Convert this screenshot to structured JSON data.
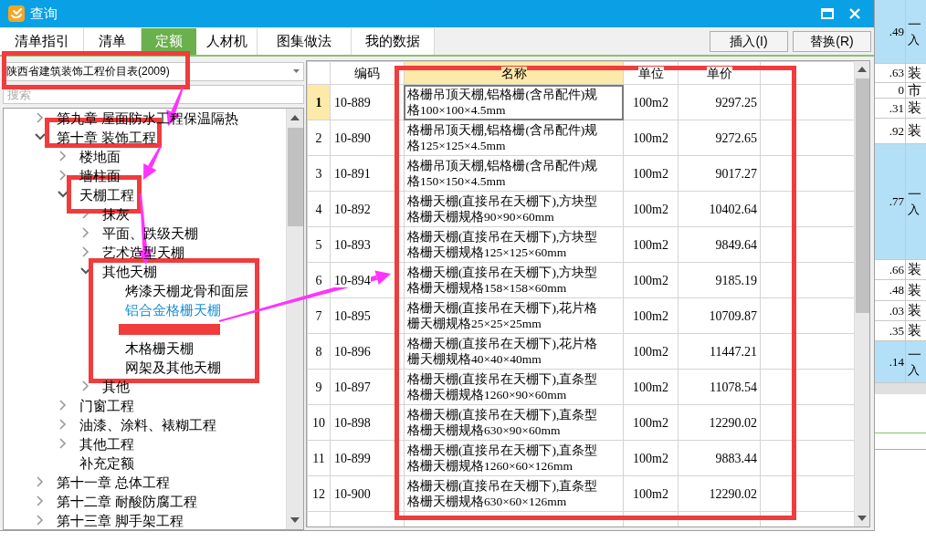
{
  "window": {
    "title": "查询"
  },
  "tabs": [
    {
      "label": "清单指引",
      "selected": false
    },
    {
      "label": "清单",
      "selected": false
    },
    {
      "label": "定额",
      "selected": true
    },
    {
      "label": "人材机",
      "selected": false
    },
    {
      "label": "图集做法",
      "selected": false
    },
    {
      "label": "我的数据",
      "selected": false
    }
  ],
  "buttons": [
    "插入(I)",
    "替换(R)"
  ],
  "library_dropdown": {
    "value": "陕西省建筑装饰工程价目表(2009)"
  },
  "search": {
    "placeholder": "搜索"
  },
  "tree": [
    {
      "label": "第九章 屋面防水工程保温隔热",
      "expanded": false,
      "selected": false
    },
    {
      "label": "第十章 装饰工程",
      "expanded": true,
      "selected": false,
      "children": [
        {
          "label": "楼地面",
          "expanded": false,
          "selected": false
        },
        {
          "label": "墙柱面",
          "expanded": false,
          "selected": false
        },
        {
          "label": "天棚工程",
          "expanded": true,
          "selected": false,
          "children": [
            {
              "label": "抹灰",
              "expanded": false,
              "selected": false
            },
            {
              "label": "平面、跌级天棚",
              "expanded": false,
              "selected": false
            },
            {
              "label": "艺术造型天棚",
              "expanded": false,
              "selected": false
            },
            {
              "label": "其他天棚",
              "expanded": true,
              "selected": false,
              "children": [
                {
                  "label": "烤漆天棚龙骨和面层",
                  "selected": false
                },
                {
                  "label": "铝合金格栅天棚",
                  "selected": true
                },
                {
                  "kind": "redacted"
                },
                {
                  "label": "木格栅天棚",
                  "selected": false
                },
                {
                  "label": "网架及其他天棚",
                  "selected": false
                }
              ]
            },
            {
              "label": "其他",
              "expanded": false,
              "selected": false
            }
          ]
        },
        {
          "label": "门窗工程",
          "expanded": false,
          "selected": false
        },
        {
          "label": "油漆、涂料、裱糊工程",
          "expanded": false,
          "selected": false
        },
        {
          "label": "其他工程",
          "expanded": false,
          "selected": false
        },
        {
          "label": "补充定额",
          "selected": false
        }
      ]
    },
    {
      "label": "第十一章 总体工程",
      "expanded": false,
      "selected": false
    },
    {
      "label": "第十二章 耐酸防腐工程",
      "expanded": false,
      "selected": false
    },
    {
      "label": "第十三章 脚手架工程",
      "expanded": false,
      "selected": false
    }
  ],
  "table": {
    "columns": [
      {
        "label": "编码",
        "selected": false
      },
      {
        "label": "名称",
        "selected": true
      },
      {
        "label": "单位",
        "selected": false
      },
      {
        "label": "单价",
        "selected": false
      }
    ],
    "rows": [
      {
        "no": "1",
        "code": "10-889",
        "name": "格栅吊顶天棚,铝格栅(含吊配件)规格100×100×4.5mm",
        "unit": "100m2",
        "price": "9297.25",
        "selected": true
      },
      {
        "no": "2",
        "code": "10-890",
        "name": "格栅吊顶天棚,铝格栅(含吊配件)规格125×125×4.5mm",
        "unit": "100m2",
        "price": "9272.65",
        "selected": false
      },
      {
        "no": "3",
        "code": "10-891",
        "name": "格栅吊顶天棚,铝格栅(含吊配件)规格150×150×4.5mm",
        "unit": "100m2",
        "price": "9017.27",
        "selected": false
      },
      {
        "no": "4",
        "code": "10-892",
        "name": "格栅天棚(直接吊在天棚下),方块型格栅天棚规格90×90×60mm",
        "unit": "100m2",
        "price": "10402.64",
        "selected": false
      },
      {
        "no": "5",
        "code": "10-893",
        "name": "格栅天棚(直接吊在天棚下),方块型格栅天棚规格125×125×60mm",
        "unit": "100m2",
        "price": "9849.64",
        "selected": false
      },
      {
        "no": "6",
        "code": "10-894",
        "name": "格栅天棚(直接吊在天棚下),方块型格栅天棚规格158×158×60mm",
        "unit": "100m2",
        "price": "9185.19",
        "selected": false
      },
      {
        "no": "7",
        "code": "10-895",
        "name": "格栅天棚(直接吊在天棚下),花片格栅天棚规格25×25×25mm",
        "unit": "100m2",
        "price": "10709.87",
        "selected": false
      },
      {
        "no": "8",
        "code": "10-896",
        "name": "格栅天棚(直接吊在天棚下),花片格栅天棚规格40×40×40mm",
        "unit": "100m2",
        "price": "11447.21",
        "selected": false
      },
      {
        "no": "9",
        "code": "10-897",
        "name": "格栅天棚(直接吊在天棚下),直条型格栅天棚规格1260×90×60mm",
        "unit": "100m2",
        "price": "11078.54",
        "selected": false
      },
      {
        "no": "10",
        "code": "10-898",
        "name": "格栅天棚(直接吊在天棚下),直条型格栅天棚规格630×90×60mm",
        "unit": "100m2",
        "price": "12290.02",
        "selected": false
      },
      {
        "no": "11",
        "code": "10-899",
        "name": "格栅天棚(直接吊在天棚下),直条型格栅天棚规格1260×60×126mm",
        "unit": "100m2",
        "price": "9883.44",
        "selected": false
      },
      {
        "no": "12",
        "code": "10-900",
        "name": "格栅天棚(直接吊在天棚下),直条型格栅天棚规格630×60×126mm",
        "unit": "100m2",
        "price": "12290.02",
        "selected": false
      }
    ]
  },
  "background_table": {
    "rows": [
      {
        "value": ".49",
        "text": "一",
        "note": "入",
        "highlighted": true
      },
      {
        "value": ".63",
        "text": "装",
        "highlighted": false
      },
      {
        "value": "0",
        "text": "市",
        "highlighted": false
      },
      {
        "value": ".31",
        "text": "装",
        "highlighted": false
      },
      {
        "value": ".92",
        "text": "装",
        "highlighted": false
      },
      {
        "value": ".77",
        "text": "一",
        "note": "入",
        "highlighted": true
      },
      {
        "value": ".66",
        "text": "装",
        "highlighted": false
      },
      {
        "value": ".48",
        "text": "装",
        "highlighted": false
      },
      {
        "value": ".03",
        "text": "装",
        "highlighted": false
      },
      {
        "value": ".35",
        "text": "装",
        "highlighted": false
      },
      {
        "value": ".14",
        "text": "一",
        "note": "入",
        "highlighted": true
      }
    ]
  }
}
